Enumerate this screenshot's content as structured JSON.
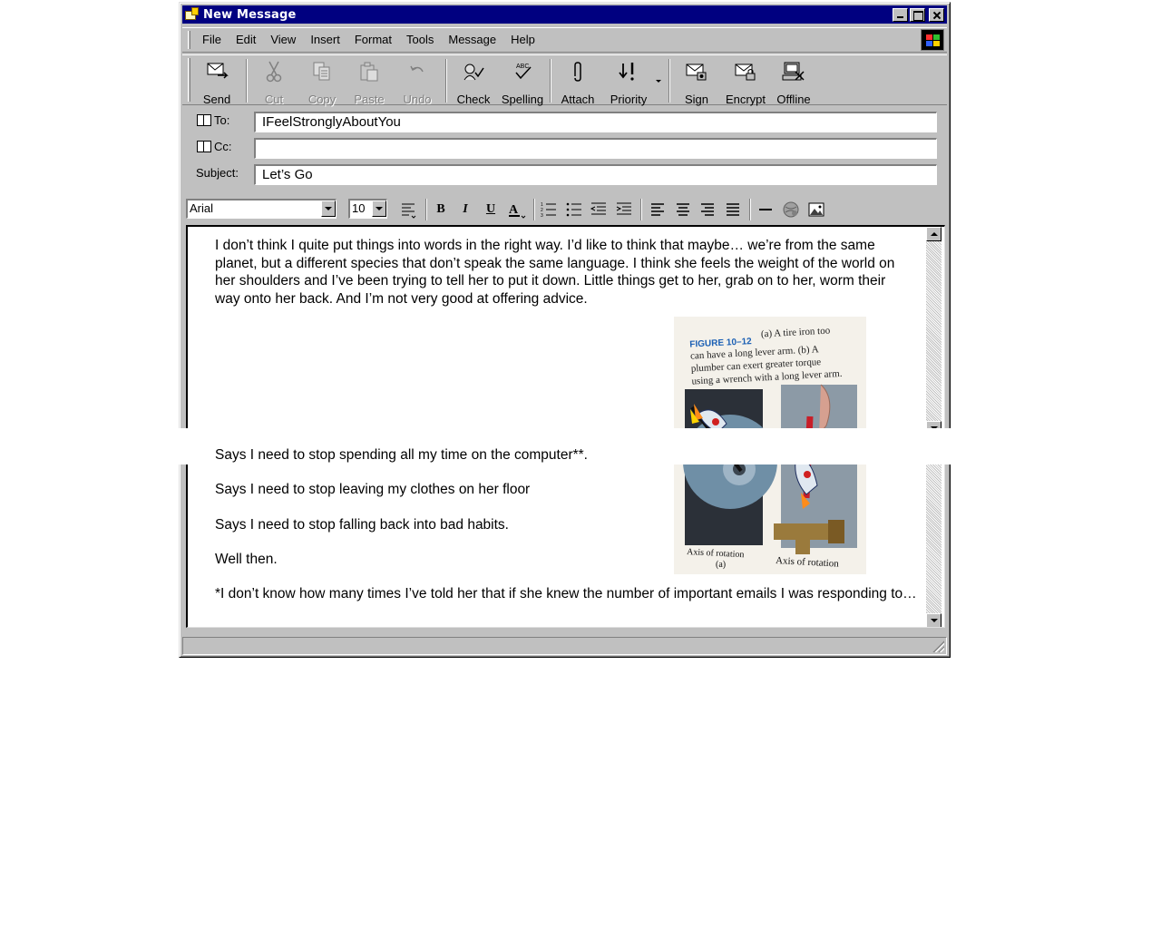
{
  "window": {
    "title": "New Message"
  },
  "menu": [
    "File",
    "Edit",
    "View",
    "Insert",
    "Format",
    "Tools",
    "Message",
    "Help"
  ],
  "toolbar": {
    "send": "Send",
    "cut": "Cut",
    "copy": "Copy",
    "paste": "Paste",
    "undo": "Undo",
    "check": "Check",
    "spelling": "Spelling",
    "attach": "Attach",
    "priority": "Priority",
    "sign": "Sign",
    "encrypt": "Encrypt",
    "offline": "Offline"
  },
  "header": {
    "to_label": "To:",
    "to_value": "IFeelStronglyAboutYou",
    "cc_label": "Cc:",
    "cc_value": "",
    "subject_label": "Subject:",
    "subject_value": "Let’s Go"
  },
  "format": {
    "font": "Arial",
    "size": "10"
  },
  "body": {
    "p1": "I don’t think I quite put things into words in the right way. I’d like to think that maybe… we’re from the same planet, but a different species that don’t speak the same language. I think she feels the weight of the world on her shoulders and I’ve been trying to tell her to put it down. Little things get to her, grab on to her, worm their way onto her back. And I’m not very good at offering advice.",
    "p2": "Says I need to stop spending all my time on the computer**.",
    "p3": "Says I need to stop leaving my clothes on her floor",
    "p4": "Says I need to stop falling back into bad habits.",
    "p5": "Well then.",
    "p6": "*I don’t know how many times I’ve told her that if she knew the number of important emails I was responding to…"
  },
  "figure": {
    "label": "FIGURE 10–12",
    "caption_1": "(a) A tire iron too",
    "caption_2": "can have a long lever arm. (b) A",
    "caption_3": "plumber can exert greater torque",
    "caption_4": "using a wrench with a long lever arm.",
    "axis_a": "Axis of rotation",
    "axis_a_sub": "(a)",
    "axis_b": "Axis of rotation"
  },
  "colors": {
    "title_bar": "#000080",
    "face": "#c0c0c0"
  }
}
